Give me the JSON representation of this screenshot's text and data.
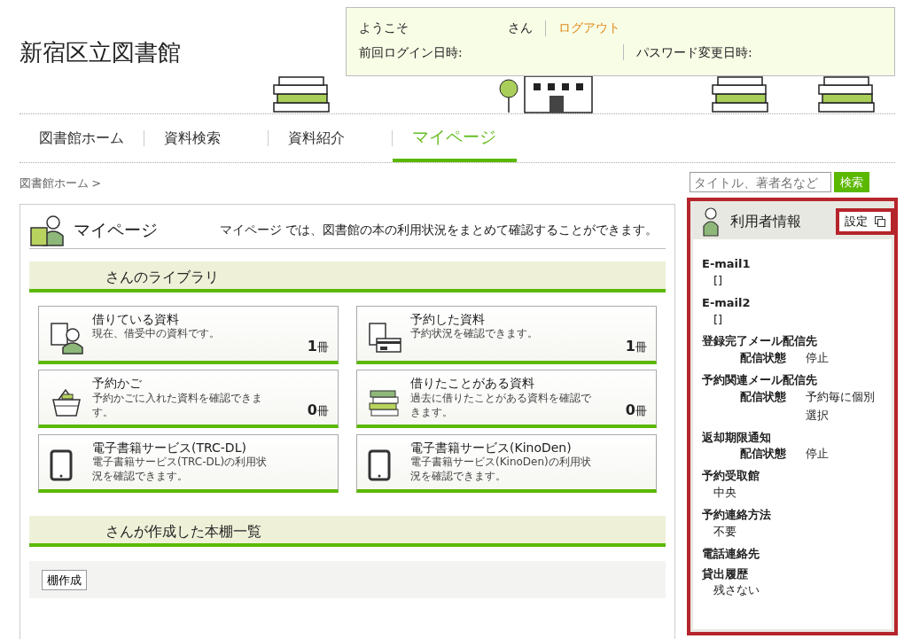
{
  "header": {
    "site_title": "新宿区立図書館",
    "welcome": "ようこそ",
    "honorific": "さん",
    "logout": "ログアウト",
    "last_login_label": "前回ログイン日時:",
    "password_changed_label": "パスワード変更日時:"
  },
  "nav": {
    "tabs": [
      {
        "label": "図書館ホーム",
        "selected": false
      },
      {
        "label": "資料検索",
        "selected": false
      },
      {
        "label": "資料紹介",
        "selected": false
      },
      {
        "label": "マイページ",
        "selected": true
      }
    ]
  },
  "breadcrumb": {
    "link": "図書館ホーム",
    "separator": ">"
  },
  "search": {
    "placeholder": "タイトル、著者名など",
    "button": "検索"
  },
  "mypage": {
    "title": "マイページ",
    "intro": "マイページ では、図書館の本の利用状況をまとめて確認することができます。",
    "library_heading": "さんのライブラリ",
    "cards": [
      {
        "kind": "borrowed",
        "title": "借りている資料",
        "description": "現在、借受中の資料です。",
        "count": "**1**冊"
      },
      {
        "kind": "reserved",
        "title": "予約した資料",
        "description": "予約状況を確認できます。",
        "count": "**1**冊"
      },
      {
        "kind": "basket",
        "title": "予約かご",
        "description": "予約かごに入れた資料を確認できます。",
        "count": "**0**冊"
      },
      {
        "kind": "history",
        "title": "借りたことがある資料",
        "description": "過去に借りたことがある資料を確認できます。",
        "count": "**0**冊"
      },
      {
        "kind": "ebook",
        "title": "電子書籍サービス(TRC-DL)",
        "description": "電子書籍サービス(TRC-DL)の利用状況を確認できます。"
      },
      {
        "kind": "ebook",
        "title": "電子書籍サービス(KinoDen)",
        "description": "電子書籍サービス(KinoDen)の利用状況を確認できます。"
      }
    ],
    "shelves_heading": "さんが作成した本棚一覧",
    "create_shelf_button": "棚作成"
  },
  "user_info": {
    "title": "利用者情報",
    "settings_button": "設定",
    "items": [
      {
        "kind": "plain",
        "label": "E-mail1",
        "value": "[]"
      },
      {
        "kind": "plain",
        "label": "E-mail2",
        "value": "[]"
      },
      {
        "kind": "status",
        "label": "登録完了メール配信先",
        "sub_label": "配信状態",
        "value": "停止"
      },
      {
        "kind": "status",
        "label": "予約関連メール配信先",
        "sub_label": "配信状態",
        "value": "予約毎に個別選択"
      },
      {
        "kind": "status",
        "label": "返却期限通知",
        "sub_label": "配信状態",
        "value": "停止"
      },
      {
        "kind": "plain",
        "label": "予約受取館",
        "value": "中央"
      },
      {
        "kind": "plain",
        "label": "予約連絡方法",
        "value": "不要"
      },
      {
        "kind": "plain",
        "label": "電話連絡先"
      },
      {
        "kind": "plain",
        "label": "貸出履歴",
        "value": "残さない"
      }
    ]
  }
}
